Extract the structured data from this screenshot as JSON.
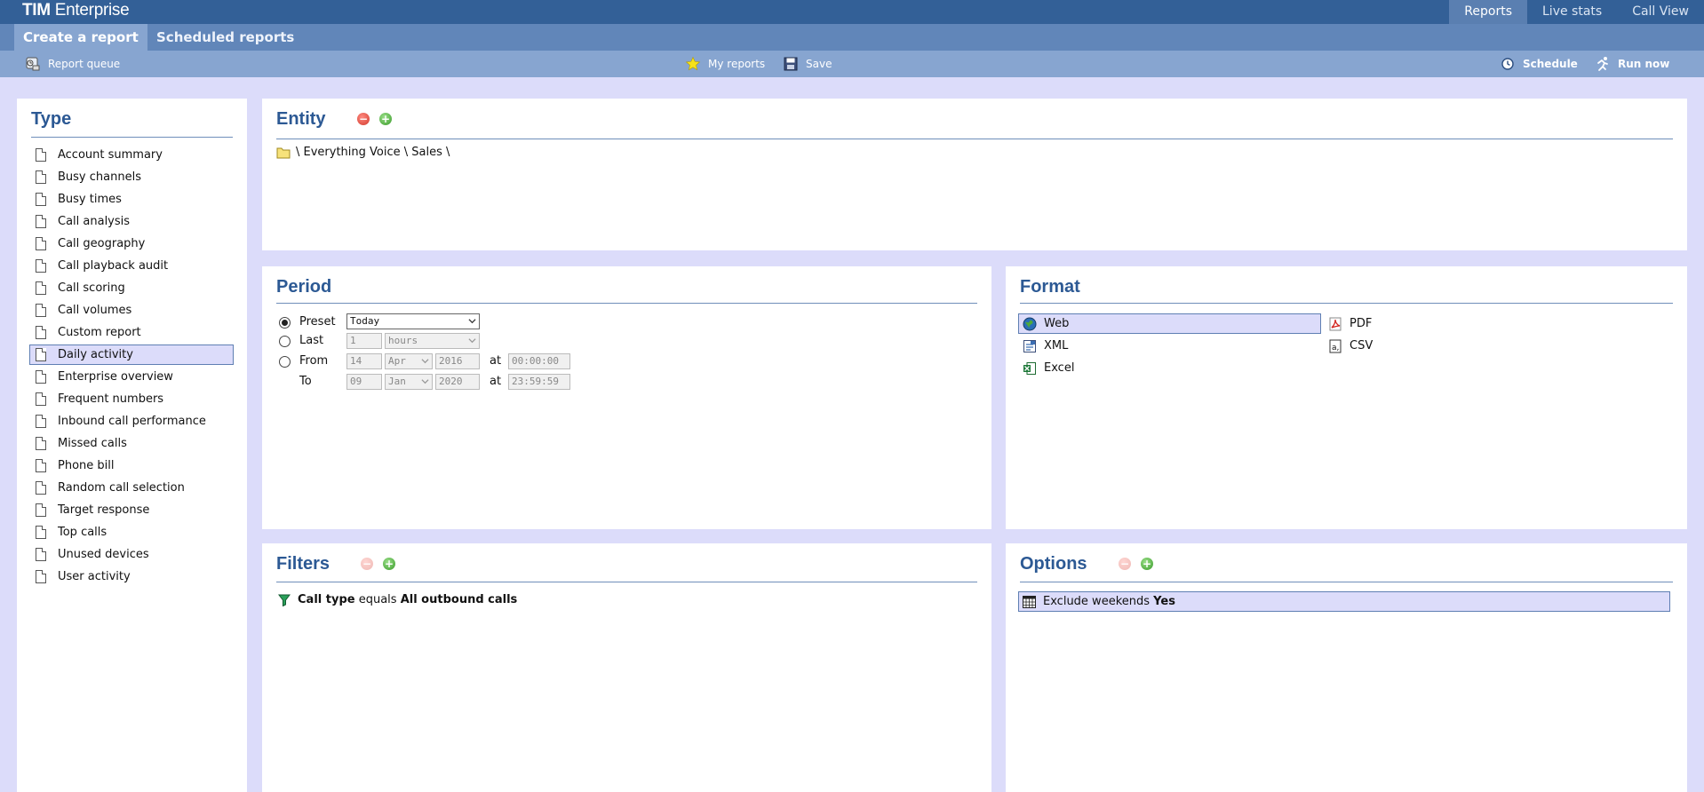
{
  "app": {
    "title_bold": "TIM",
    "title_rest": "Enterprise"
  },
  "topnav": [
    {
      "label": "Reports",
      "active": true
    },
    {
      "label": "Live stats",
      "active": false
    },
    {
      "label": "Call View",
      "active": false
    }
  ],
  "subnav": [
    {
      "label": "Create a report",
      "active": true
    },
    {
      "label": "Scheduled reports",
      "active": false
    }
  ],
  "toolbar": {
    "report_queue": "Report queue",
    "my_reports": "My reports",
    "save": "Save",
    "schedule": "Schedule",
    "run_now": "Run now"
  },
  "type_panel": {
    "title": "Type",
    "selected": "Daily activity",
    "items": [
      "Account summary",
      "Busy channels",
      "Busy times",
      "Call analysis",
      "Call geography",
      "Call playback audit",
      "Call scoring",
      "Call volumes",
      "Custom report",
      "Daily activity",
      "Enterprise overview",
      "Frequent numbers",
      "Inbound call performance",
      "Missed calls",
      "Phone bill",
      "Random call selection",
      "Target response",
      "Top calls",
      "Unused devices",
      "User activity"
    ]
  },
  "entity_panel": {
    "title": "Entity",
    "path": "\\ Everything Voice \\ Sales \\"
  },
  "period_panel": {
    "title": "Period",
    "selected_mode": "Preset",
    "preset_label": "Preset",
    "preset_value": "Today",
    "last_label": "Last",
    "last_count": "1",
    "last_unit": "hours",
    "from_label": "From",
    "from_day": "14",
    "from_month": "Apr",
    "from_year": "2016",
    "from_time": "00:00:00",
    "to_label": "To",
    "to_day": "09",
    "to_month": "Jan",
    "to_year": "2020",
    "to_time": "23:59:59",
    "at_label": "at"
  },
  "format_panel": {
    "title": "Format",
    "selected": "Web",
    "web": "Web",
    "xml": "XML",
    "excel": "Excel",
    "pdf": "PDF",
    "csv": "CSV"
  },
  "filters_panel": {
    "title": "Filters",
    "field": "Call type",
    "operator": "equals",
    "value": "All outbound calls"
  },
  "options_panel": {
    "title": "Options",
    "option": "Exclude weekends",
    "option_value": "Yes"
  },
  "colors": {
    "topbar": "#336097",
    "accent": "#2c5994",
    "background": "#dcdcfa",
    "selection": "#dcdcfa"
  }
}
